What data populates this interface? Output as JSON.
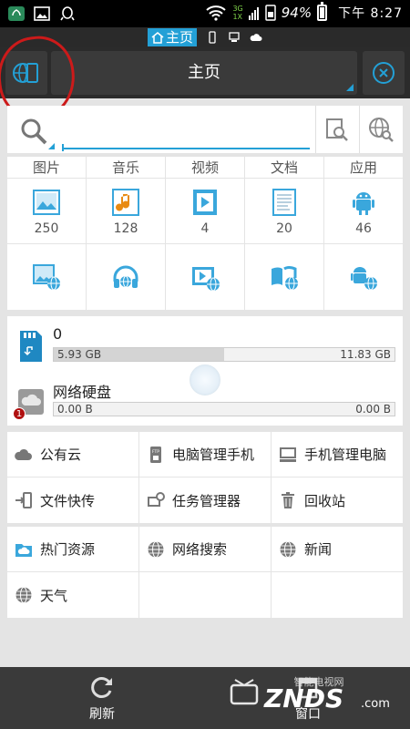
{
  "status_bar": {
    "battery": "94%",
    "time": "下午 8:27",
    "net_top": "3G",
    "net_bottom": "1X"
  },
  "tab_bar": {
    "active_tab": "主页"
  },
  "title_bar": {
    "title": "主页"
  },
  "search": {
    "value": ""
  },
  "categories": [
    {
      "label": "图片",
      "count": "250",
      "icon": "image-icon"
    },
    {
      "label": "音乐",
      "count": "128",
      "icon": "music-icon"
    },
    {
      "label": "视频",
      "count": "4",
      "icon": "video-icon"
    },
    {
      "label": "文档",
      "count": "20",
      "icon": "document-icon"
    },
    {
      "label": "应用",
      "count": "46",
      "icon": "android-icon"
    }
  ],
  "storage": [
    {
      "name": "0",
      "used": "5.93 GB",
      "total": "11.83 GB",
      "used_fraction": 0.5
    },
    {
      "name": "网络硬盘",
      "used": "0.00 B",
      "total": "0.00 B",
      "used_fraction": 0,
      "badge": "1"
    }
  ],
  "tools": [
    {
      "label": "公有云",
      "icon": "cloud-icon"
    },
    {
      "label": "电脑管理手机",
      "icon": "ftp-icon"
    },
    {
      "label": "手机管理电脑",
      "icon": "computer-icon"
    },
    {
      "label": "文件快传",
      "icon": "transfer-icon"
    },
    {
      "label": "任务管理器",
      "icon": "task-manager-icon"
    },
    {
      "label": "回收站",
      "icon": "trash-icon"
    }
  ],
  "resources": [
    {
      "label": "热门资源",
      "icon": "folder-cloud-icon"
    },
    {
      "label": "网络搜索",
      "icon": "globe-icon"
    },
    {
      "label": "新闻",
      "icon": "globe-icon"
    },
    {
      "label": "天气",
      "icon": "globe-icon"
    }
  ],
  "bottom_bar": {
    "refresh": "刷新",
    "window": "窗口"
  },
  "watermark": {
    "brand": "ZNDS",
    "suffix": ".com",
    "site": "智能电视网"
  },
  "colors": {
    "accent": "#23a0d6",
    "annotation": "#cc1a1a"
  }
}
